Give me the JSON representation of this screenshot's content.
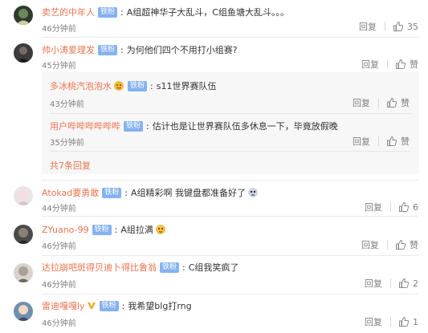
{
  "labels": {
    "reply": "回复",
    "like": "赞",
    "badge": "铁粉"
  },
  "comments": [
    {
      "user": "卖艺的中年人",
      "text": "A组超神华子大乱斗，C组鱼塘大乱斗。。。",
      "time": "46分钟前",
      "likes": "35"
    },
    {
      "user": "帅小涛爱理发",
      "text": "为何他们四个不用打小组赛?",
      "time": "45分钟前",
      "likes": "赞"
    },
    {
      "user": "Atokad要勇敢",
      "text": "A组精彩啊 我键盘都准备好了",
      "time": "44分钟前",
      "likes": "6"
    },
    {
      "user": "ZYuano-99",
      "text": "A组拉满",
      "time": "46分钟前",
      "likes": "赞"
    },
    {
      "user": "达拉崩吧斑得贝迪卜得比鲁翁",
      "text": "C组我笑疯了",
      "time": "46分钟前",
      "likes": "2"
    },
    {
      "user": "雷迪嘎嘎ly",
      "text": "我希望blg打rng",
      "time": "46分钟前",
      "likes": "1"
    }
  ],
  "replies": [
    {
      "user": "多冰桃汽泡泡水",
      "text": "s11世界赛队伍",
      "time": "43分钟前",
      "likes": "赞"
    },
    {
      "user": "用户哔哔哔哔哔哔",
      "text": "估计也是让世界赛队伍多休息一下，毕竟放假晚",
      "time": "35分钟前",
      "likes": "赞"
    }
  ],
  "more_replies": "共7条回复",
  "colors": {
    "username": "#eb7350",
    "badge": "#85b2f0",
    "time": "#808080"
  }
}
